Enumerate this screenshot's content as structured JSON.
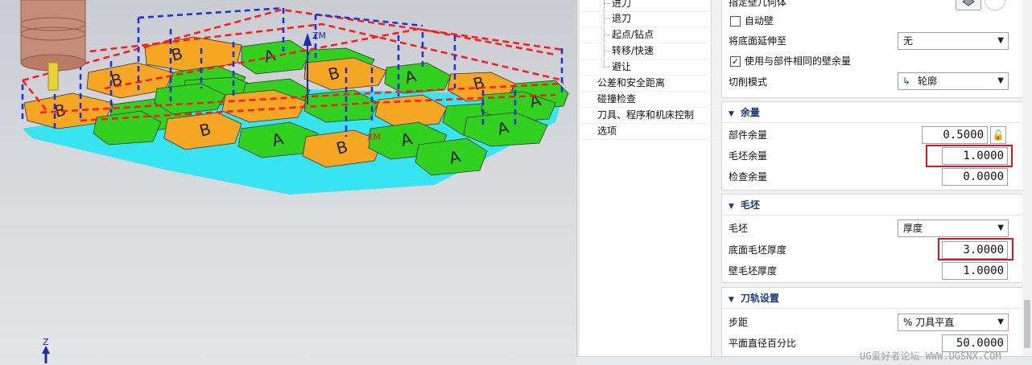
{
  "viewport": {
    "axes": {
      "zm_label": "ZM",
      "xm_label": "XM",
      "z_label": "Z"
    },
    "parts": [
      {
        "letter": "B",
        "color": "orange"
      },
      {
        "letter": "A",
        "color": "green"
      },
      {
        "letter": "B",
        "color": "orange"
      },
      {
        "letter": "A",
        "color": "green"
      },
      {
        "letter": "B",
        "color": "orange"
      },
      {
        "letter": "A",
        "color": "green"
      }
    ]
  },
  "tree": {
    "items": [
      {
        "label": "进刀"
      },
      {
        "label": "退刀"
      },
      {
        "label": "起点/钻点"
      },
      {
        "label": "转移/快速"
      },
      {
        "label": "避让"
      },
      {
        "label": "公差和安全距离"
      },
      {
        "label": "碰撞检查"
      },
      {
        "label": "刀具、程序和机床控制"
      },
      {
        "label": "选项"
      }
    ]
  },
  "props": {
    "top": {
      "specify_wall_label": "指定壁几何体",
      "auto_wall_label": "自动壁",
      "auto_wall_checked": false,
      "extend_floor_label": "将底面延伸至",
      "extend_floor_value": "无",
      "same_wall_stock_label": "使用与部件相同的壁余量",
      "same_wall_stock_checked": true,
      "cut_pattern_label": "切削模式",
      "cut_pattern_value": "轮廓"
    },
    "stock_panel": {
      "title": "余量",
      "part_stock_label": "部件余量",
      "part_stock_value": "0.5000",
      "blank_stock_label": "毛坯余量",
      "blank_stock_value": "1.0000",
      "check_stock_label": "检查余量",
      "check_stock_value": "0.0000"
    },
    "blank_panel": {
      "title": "毛坯",
      "blank_label": "毛坯",
      "blank_value": "厚度",
      "floor_blank_label": "底面毛坯厚度",
      "floor_blank_value": "3.0000",
      "wall_blank_label": "壁毛坯厚度",
      "wall_blank_value": "1.0000"
    },
    "path_panel": {
      "title": "刀轨设置",
      "stepover_label": "步距",
      "stepover_value": "% 刀具平直",
      "percent_label": "平面直径百分比",
      "percent_value": "50.0000"
    }
  },
  "watermark": "UG爱好者论坛 WWW.UGSNX.COM",
  "colors": {
    "accent_header": "#1b3a7a",
    "highlight_red": "#e0141e",
    "part_orange": "#f5a623",
    "part_green": "#33d11f",
    "part_cyan": "#2ee6f2"
  }
}
